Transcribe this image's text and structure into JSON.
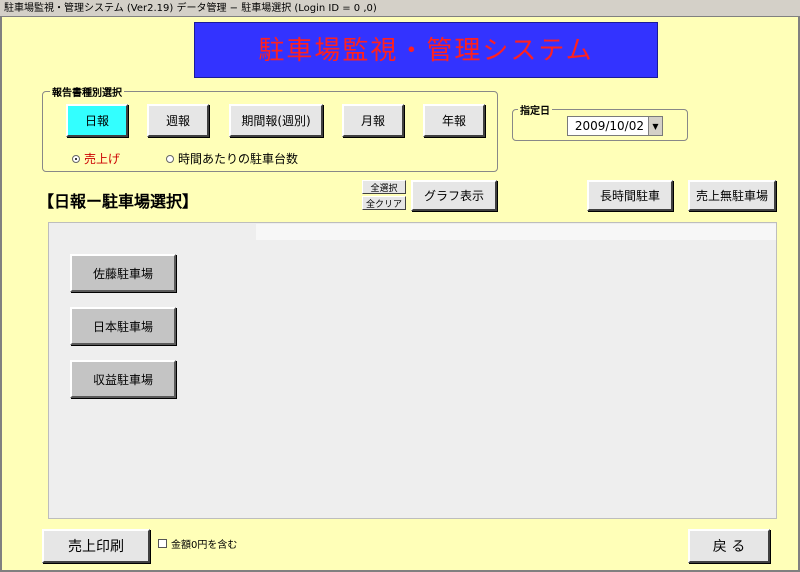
{
  "window": {
    "title": "駐車場監視・管理システム (Ver2.19)  データ管理 − 駐車場選択 (Login ID = 0          ,0)"
  },
  "banner": {
    "text": "駐車場監視・管理システム"
  },
  "report_type": {
    "group_label": "報告書種別選択",
    "buttons": [
      {
        "label": "日報",
        "active": true
      },
      {
        "label": "週報",
        "active": false
      },
      {
        "label": "期間報(週別)",
        "active": false
      },
      {
        "label": "月報",
        "active": false
      },
      {
        "label": "年報",
        "active": false
      }
    ],
    "radios": [
      {
        "label": "売上げ",
        "selected": true,
        "color": "#cc0000"
      },
      {
        "label": "時間あたりの駐車台数",
        "selected": false
      }
    ]
  },
  "date": {
    "group_label": "指定日",
    "value": "2009/10/02"
  },
  "section_title": "【日報ー駐車場選択】",
  "select_all_label": "全選択",
  "clear_all_label": "全クリア",
  "graph_button": "グラフ表示",
  "long_term_button": "長時間駐車",
  "no_sales_button": "売上無駐車場",
  "lots": [
    {
      "label": "佐藤駐車場"
    },
    {
      "label": "日本駐車場"
    },
    {
      "label": "収益駐車場"
    }
  ],
  "footer": {
    "print_button": "売上印刷",
    "include_zero_label": "金額0円を含む",
    "back_button": "戻 る"
  }
}
